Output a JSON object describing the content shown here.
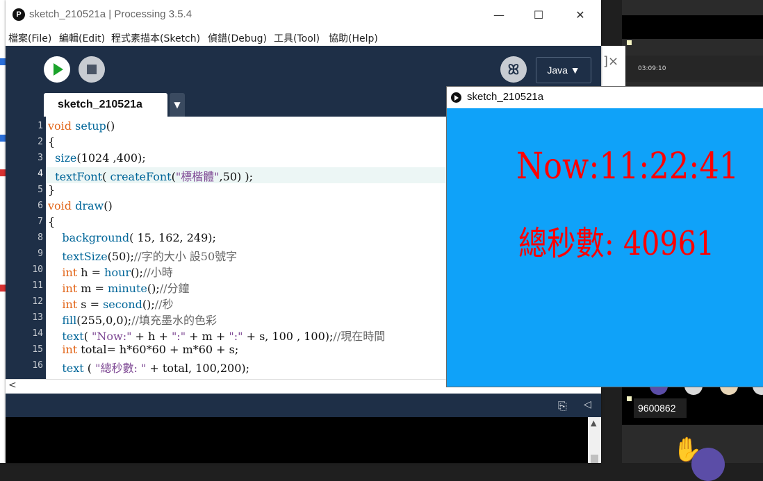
{
  "window": {
    "title": "sketch_210521a | Processing 3.5.4",
    "app_icon": "processing-logo-icon",
    "minimize": "—",
    "maximize": "☐",
    "close": "✕"
  },
  "menu": [
    "檔案(File)",
    "編輯(Edit)",
    "程式素描本(Sketch)",
    "偵錯(Debug)",
    "工具(Tool)",
    "協助(Help)"
  ],
  "toolbar": {
    "run_icon": "play-icon",
    "stop_icon": "stop-icon",
    "debug_icon": "butterfly-debug-icon",
    "mode": "Java ▼"
  },
  "tab": {
    "name": "sketch_210521a",
    "menu": "▼"
  },
  "editor": {
    "current_line": 4,
    "line_numbers": [
      "1",
      "2",
      "3",
      "4",
      "5",
      "6",
      "7",
      "8",
      "9",
      "10",
      "11",
      "12",
      "13",
      "14",
      "15",
      "16"
    ],
    "lines": [
      "void setup()",
      "{",
      "  size(1024 ,400);",
      "  textFont( createFont(\"標楷體\",50) );",
      "}",
      "void draw()",
      "{",
      "    background( 15, 162, 249);",
      "    textSize(50);//字的大小 設50號字",
      "    int h = hour();//小時",
      "    int m = minute();//分鐘",
      "    int s = second();//秒",
      "    fill(255,0,0);//填充墨水的色彩",
      "    text( \"Now:\" + h + \":\" + m + \":\" + s, 100 , 100);//現在時間",
      "    int total= h*60*60 + m*60 + s;",
      "    text ( \"總秒數: \" + total, 100,200);"
    ]
  },
  "sketch_window": {
    "title": "sketch_210521a",
    "background_color": "#0fa2f9",
    "text_color": "#ff0000",
    "line1": "Now:11:22:41",
    "line2": "總秒數: 40961"
  },
  "side_panel": {
    "time": "03:09:10",
    "meeting_id": "9600862",
    "hand_icon": "raised-hand-icon"
  },
  "behind_window": {
    "glyph": "]×"
  }
}
